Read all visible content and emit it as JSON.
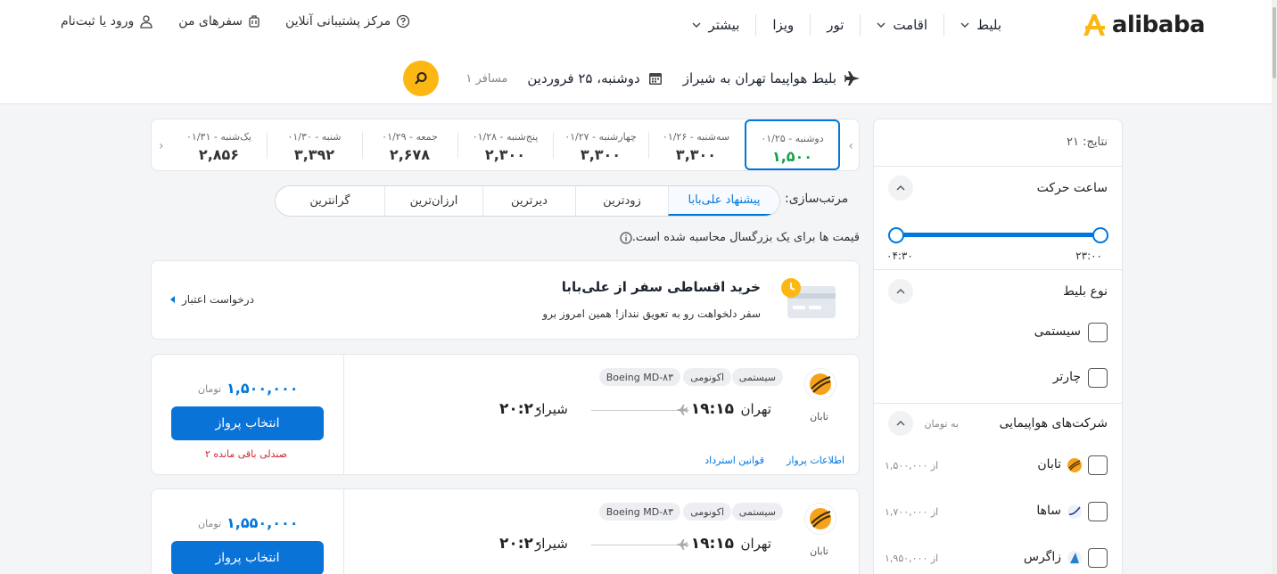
{
  "brand": {
    "name": "alibaba",
    "color": "#fdb713"
  },
  "topnav": {
    "items": [
      {
        "label": "بلیط",
        "has_chevron": true
      },
      {
        "label": "اقامت",
        "has_chevron": true
      },
      {
        "label": "تور",
        "has_chevron": false
      },
      {
        "label": "ویزا",
        "has_chevron": false
      },
      {
        "label": "بیشتر",
        "has_chevron": true
      }
    ]
  },
  "usernav": {
    "support": "مرکز پشتیبانی آنلاین",
    "trips": "سفرهای من",
    "login": "ورود یا ثبت‌نام"
  },
  "search": {
    "route": "بلیط هواپیما تهران به شیراز",
    "date": "دوشنبه، ۲۵ فروردین",
    "passengers": "۱ مسافر"
  },
  "sidebar": {
    "results": "نتایج: ۲۱",
    "depart_time": {
      "title": "ساعت حرکت",
      "from": "۰۴:۳۰",
      "to": "۲۳:۰۰"
    },
    "ticket_type": {
      "title": "نوع بلیط",
      "options": [
        "سیستمی",
        "چارتر"
      ]
    },
    "airlines": {
      "title": "شرکت‌های هواپیمایی",
      "unit": "به تومان",
      "items": [
        {
          "name": "تابان",
          "price": "از ۱,۵۰۰,۰۰۰"
        },
        {
          "name": "ساها",
          "price": "از ۱,۷۰۰,۰۰۰"
        },
        {
          "name": "زاگرس",
          "price": "از ۱,۹۵۰,۰۰۰"
        }
      ]
    }
  },
  "dates": [
    {
      "label": "دوشنبه - ۰۱/۲۵",
      "price": "۱,۵۰۰",
      "active": true
    },
    {
      "label": "سه‌شنبه - ۰۱/۲۶",
      "price": "۳,۳۰۰"
    },
    {
      "label": "چهارشنبه - ۰۱/۲۷",
      "price": "۳,۳۰۰"
    },
    {
      "label": "پنج‌شنبه - ۰۱/۲۸",
      "price": "۲,۳۰۰"
    },
    {
      "label": "جمعه - ۰۱/۲۹",
      "price": "۲,۶۷۸"
    },
    {
      "label": "شنبه - ۰۱/۳۰",
      "price": "۳,۳۹۲"
    },
    {
      "label": "یک‌شنبه - ۰۱/۳۱",
      "price": "۲,۸۵۶"
    }
  ],
  "sort": {
    "label": "مرتب‌سازی:",
    "tabs": [
      "پیشنهاد علی‌بابا",
      "زودترین",
      "دیرترین",
      "ارزان‌ترین",
      "گرانترین"
    ]
  },
  "note": "قیمت ها برای یک بزرگسال محاسبه شده است.",
  "promo": {
    "title": "خرید اقساطی سفر از علی‌بابا",
    "subtitle": "سفر دلخواهت رو به تعویق ننداز! همین امروز برو",
    "link": "درخواست اعتبار"
  },
  "flights": [
    {
      "airline": "تابان",
      "tags": [
        "سیستمی",
        "اکونومی",
        "Boeing MD-۸۳"
      ],
      "from_city": "تهران",
      "from_time": "۱۹:۱۵",
      "to_city": "شیراز",
      "to_time": "۲۰:۲۰",
      "price": "۱,۵۰۰,۰۰۰",
      "currency": "تومان",
      "button": "انتخاب پرواز",
      "seats": "۲ صندلی باقی مانده",
      "info_link": "اطلاعات پرواز",
      "refund_link": "قوانین استرداد"
    },
    {
      "airline": "تابان",
      "tags": [
        "سیستمی",
        "اکونومی",
        "Boeing MD-۸۳"
      ],
      "from_city": "تهران",
      "from_time": "۱۹:۱۵",
      "to_city": "شیراز",
      "to_time": "۲۰:۲۰",
      "price": "۱,۵۵۰,۰۰۰",
      "currency": "تومان",
      "button": "انتخاب پرواز"
    }
  ]
}
